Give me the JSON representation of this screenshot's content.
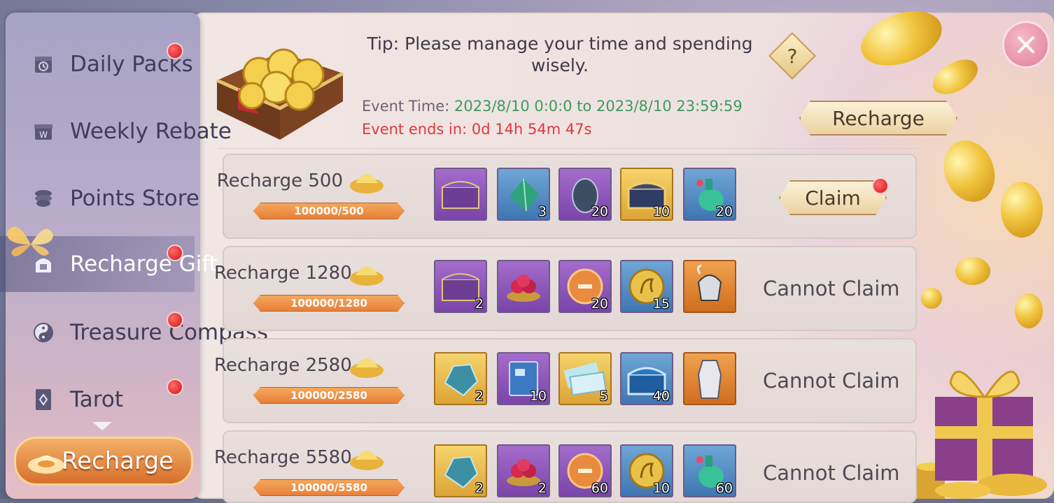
{
  "sidebar": {
    "items": [
      {
        "label": "Daily Packs",
        "icon": "gift-calendar-icon",
        "has_dot": true
      },
      {
        "label": "Weekly Rebate",
        "icon": "weekly-gift-icon",
        "has_dot": false
      },
      {
        "label": "Points Store",
        "icon": "points-stack-icon",
        "has_dot": false
      },
      {
        "label": "Recharge Gift",
        "icon": "piggy-bank-icon",
        "has_dot": true,
        "active": true
      },
      {
        "label": "Treasure Compass",
        "icon": "yin-yang-icon",
        "has_dot": true
      },
      {
        "label": "Tarot",
        "icon": "tarot-card-icon",
        "has_dot": true
      }
    ],
    "recharge_button": "Recharge"
  },
  "header": {
    "tip": "Tip: Please manage your time and spending wisely.",
    "event_time_label": "Event Time:",
    "event_time_value": "2023/8/10 0:0:0 to 2023/8/10 23:59:59",
    "event_ends": "Event ends in: 0d 14h 54m 47s",
    "help_label": "?",
    "recharge_button": "Recharge"
  },
  "rows": [
    {
      "title": "Recharge 500",
      "progress": "100000/500",
      "status": "Claim",
      "claimable": true,
      "items": [
        {
          "icon": "treasure-chest-icon",
          "rarity": "purple",
          "count": ""
        },
        {
          "icon": "green-gem-icon",
          "rarity": "blue",
          "count": "3"
        },
        {
          "icon": "silver-egg-icon",
          "rarity": "purple",
          "count": "20"
        },
        {
          "icon": "golden-chest-icon",
          "rarity": "gold",
          "count": "10"
        },
        {
          "icon": "green-potion-icon",
          "rarity": "blue",
          "count": "20"
        }
      ]
    },
    {
      "title": "Recharge 1280",
      "progress": "100000/1280",
      "status": "Cannot Claim",
      "claimable": false,
      "items": [
        {
          "icon": "treasure-chest-icon",
          "rarity": "purple",
          "count": "2"
        },
        {
          "icon": "fruit-bowl-icon",
          "rarity": "purple",
          "count": ""
        },
        {
          "icon": "bronze-coin-icon",
          "rarity": "purple",
          "count": "20"
        },
        {
          "icon": "horse-coin-icon",
          "rarity": "blue",
          "count": "15"
        },
        {
          "icon": "armor-helmet-icon",
          "rarity": "orange",
          "count": ""
        }
      ]
    },
    {
      "title": "Recharge 2580",
      "progress": "100000/2580",
      "status": "Cannot Claim",
      "claimable": false,
      "items": [
        {
          "icon": "blue-ore-icon",
          "rarity": "gold",
          "count": "2"
        },
        {
          "icon": "blue-book-icon",
          "rarity": "purple",
          "count": "10"
        },
        {
          "icon": "tickets-icon",
          "rarity": "gold",
          "count": "5"
        },
        {
          "icon": "blue-chest-icon",
          "rarity": "blue",
          "count": "40"
        },
        {
          "icon": "armor-suit-icon",
          "rarity": "orange",
          "count": ""
        }
      ]
    },
    {
      "title": "Recharge 5580",
      "progress": "100000/5580",
      "status": "Cannot Claim",
      "claimable": false,
      "items": [
        {
          "icon": "blue-ore-icon",
          "rarity": "gold",
          "count": "2"
        },
        {
          "icon": "fruit-bowl-icon",
          "rarity": "purple",
          "count": "2"
        },
        {
          "icon": "bronze-coin-icon",
          "rarity": "purple",
          "count": "60"
        },
        {
          "icon": "horse-coin-icon",
          "rarity": "blue",
          "count": "10"
        },
        {
          "icon": "green-potion-icon",
          "rarity": "blue",
          "count": "60"
        }
      ]
    }
  ],
  "colors": {
    "event_time_value": "#3c9a5c",
    "event_ends": "#e0383b",
    "progress_bar": "#e8803a",
    "red_dot": "#d21414"
  }
}
